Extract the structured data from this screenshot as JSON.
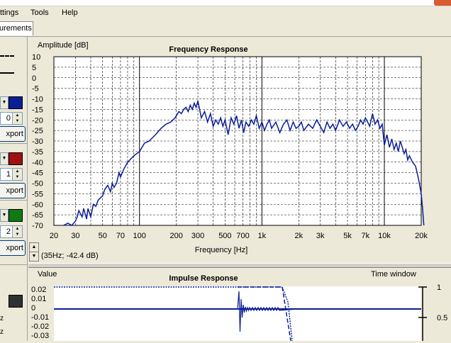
{
  "menu": {
    "items": [
      "ttings",
      "Tools",
      "Help"
    ]
  },
  "tabs": {
    "active": "urements"
  },
  "left_panel": {
    "series": [
      {
        "color": "#0a1e96",
        "spin": "0",
        "export_label": "xport"
      },
      {
        "color": "#a01010",
        "spin": "1",
        "export_label": "xport"
      },
      {
        "color": "#0f7a12",
        "spin": "2",
        "export_label": "xport"
      }
    ],
    "extra_swatch_color": "#303030",
    "bottom_labels": [
      "z",
      "z"
    ]
  },
  "freq_chart": {
    "chart_data": {
      "type": "line",
      "title": "Frequency Response",
      "xlabel": "Frequency [Hz]",
      "ylabel": "Amplitude [dB]",
      "x_scale": "log",
      "xlim": [
        20,
        20000
      ],
      "ylim": [
        -70,
        10
      ],
      "xticks": [
        "20",
        "30",
        "50",
        "70",
        "100",
        "200",
        "300",
        "500",
        "700",
        "1k",
        "2k",
        "3k",
        "5k",
        "7k",
        "10k",
        "20k"
      ],
      "yticks": [
        "10",
        "5",
        "0",
        "-5",
        "-10",
        "-15",
        "-20",
        "-25",
        "-30",
        "-35",
        "-40",
        "-45",
        "-50",
        "-55",
        "-60",
        "-65",
        "-70"
      ],
      "grid": true,
      "series": [
        {
          "color": "#0a1e96",
          "x": [
            24,
            26,
            28,
            30,
            31,
            32,
            34,
            35,
            37,
            38,
            40,
            42,
            44,
            46,
            48,
            50,
            52,
            55,
            58,
            60,
            62,
            65,
            68,
            70,
            75,
            80,
            90,
            100,
            110,
            120,
            135,
            150,
            165,
            180,
            195,
            200,
            210,
            220,
            230,
            240,
            250,
            260,
            270,
            280,
            290,
            300,
            310,
            320,
            340,
            360,
            380,
            400,
            420,
            440,
            460,
            480,
            500,
            530,
            560,
            590,
            620,
            650,
            680,
            710,
            740,
            780,
            820,
            860,
            900,
            950,
            1000,
            1050,
            1100,
            1150,
            1200,
            1300,
            1400,
            1500,
            1600,
            1700,
            1800,
            1900,
            2000,
            2100,
            2200,
            2400,
            2600,
            2800,
            3000,
            3200,
            3400,
            3600,
            3800,
            4000,
            4300,
            4600,
            4900,
            5200,
            5500,
            5800,
            6100,
            6400,
            6700,
            7000,
            7300,
            7600,
            8000,
            8400,
            8800,
            9200,
            9600,
            10000,
            10500,
            11000,
            11500,
            12000,
            12500,
            13000,
            13500,
            14000,
            14500,
            15000,
            15500,
            16000,
            17000,
            18000,
            19000,
            20000,
            20500,
            21000
          ],
          "y": [
            -70,
            -69,
            -70,
            -68,
            -66,
            -63,
            -66,
            -62,
            -67,
            -62,
            -66,
            -60,
            -61,
            -58,
            -57,
            -56,
            -53,
            -51,
            -54,
            -50,
            -52,
            -50,
            -45,
            -47,
            -43,
            -40,
            -37,
            -35,
            -31,
            -30,
            -27,
            -24,
            -22,
            -21,
            -19,
            -18,
            -16,
            -17,
            -15,
            -14,
            -16,
            -13,
            -15,
            -12,
            -14,
            -11,
            -15,
            -19,
            -16,
            -21,
            -17,
            -23,
            -20,
            -22,
            -19,
            -23,
            -20,
            -27,
            -19,
            -22,
            -18,
            -24,
            -20,
            -26,
            -21,
            -23,
            -20,
            -22,
            -18,
            -24,
            -21,
            -25,
            -22,
            -20,
            -24,
            -21,
            -26,
            -22,
            -20,
            -25,
            -21,
            -24,
            -23,
            -21,
            -25,
            -22,
            -24,
            -20,
            -23,
            -26,
            -21,
            -24,
            -22,
            -25,
            -20,
            -23,
            -21,
            -24,
            -22,
            -25,
            -23,
            -20,
            -22,
            -19,
            -21,
            -23,
            -17,
            -22,
            -20,
            -24,
            -22,
            -32,
            -27,
            -33,
            -29,
            -34,
            -31,
            -35,
            -30,
            -33,
            -36,
            -34,
            -39,
            -37,
            -40,
            -42,
            -48,
            -55,
            -62,
            -70
          ]
        }
      ]
    },
    "status_text": "(35Hz; -42.4 dB)"
  },
  "impulse_chart": {
    "chart_data": {
      "type": "line",
      "title": "Impulse Response",
      "ylabel": "Value",
      "right_label": "Time window",
      "yticks": [
        "0.02",
        "0.01",
        "0",
        "-0.01",
        "-0.02",
        "-0.03"
      ],
      "right_ticks": [
        "1",
        "0.5"
      ],
      "ylim": [
        -0.03,
        0.02
      ]
    }
  }
}
